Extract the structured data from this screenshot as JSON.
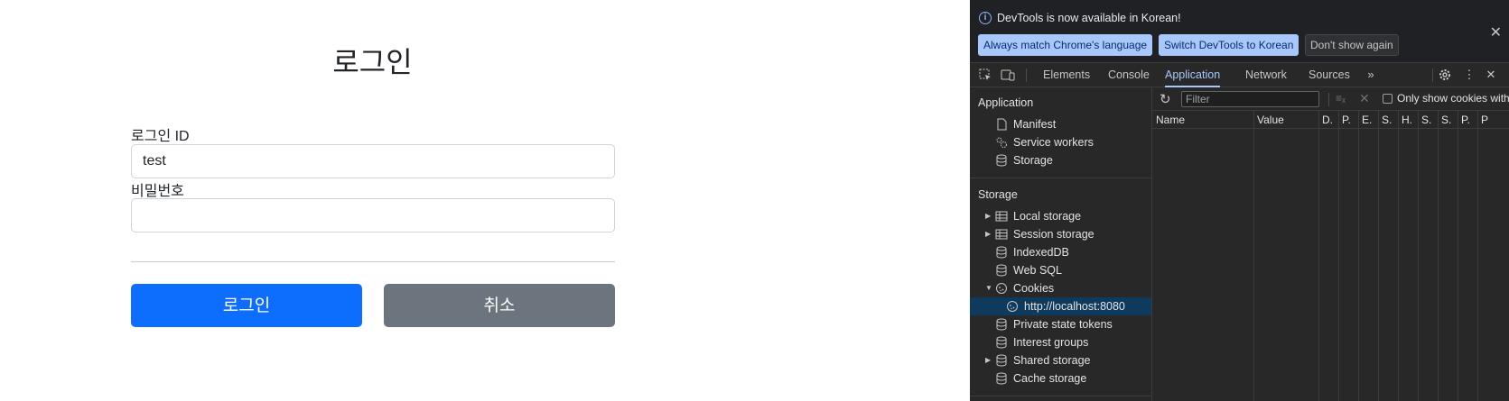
{
  "login": {
    "title": "로그인",
    "id_label": "로그인 ID",
    "id_value": "test",
    "password_label": "비밀번호",
    "password_value": "",
    "login_button": "로그인",
    "cancel_button": "취소"
  },
  "devtools": {
    "infobar": {
      "message": "DevTools is now available in Korean!",
      "btn_match": "Always match Chrome's language",
      "btn_switch": "Switch DevTools to Korean",
      "btn_dont_show": "Don't show again"
    },
    "tabs": [
      "Elements",
      "Console",
      "Application",
      "Network",
      "Sources"
    ],
    "active_tab": "Application",
    "sidebar": {
      "application_heading": "Application",
      "application_items": [
        "Manifest",
        "Service workers",
        "Storage"
      ],
      "storage_heading": "Storage",
      "storage_items": [
        "Local storage",
        "Session storage",
        "IndexedDB",
        "Web SQL",
        "Cookies",
        "http://localhost:8080",
        "Private state tokens",
        "Interest groups",
        "Shared storage",
        "Cache storage"
      ]
    },
    "cookies": {
      "filter_placeholder": "Filter",
      "only_show_label": "Only show cookies with ...",
      "columns": [
        "Name",
        "Value",
        "D.",
        "P.",
        "E.",
        "S.",
        "H.",
        "S.",
        "S.",
        "P.",
        "P"
      ]
    }
  },
  "colors": {
    "primary": "#0d6efd",
    "secondary": "#6c757d",
    "devtools_bg": "#282828",
    "devtools_accent": "#a8c7fa"
  }
}
